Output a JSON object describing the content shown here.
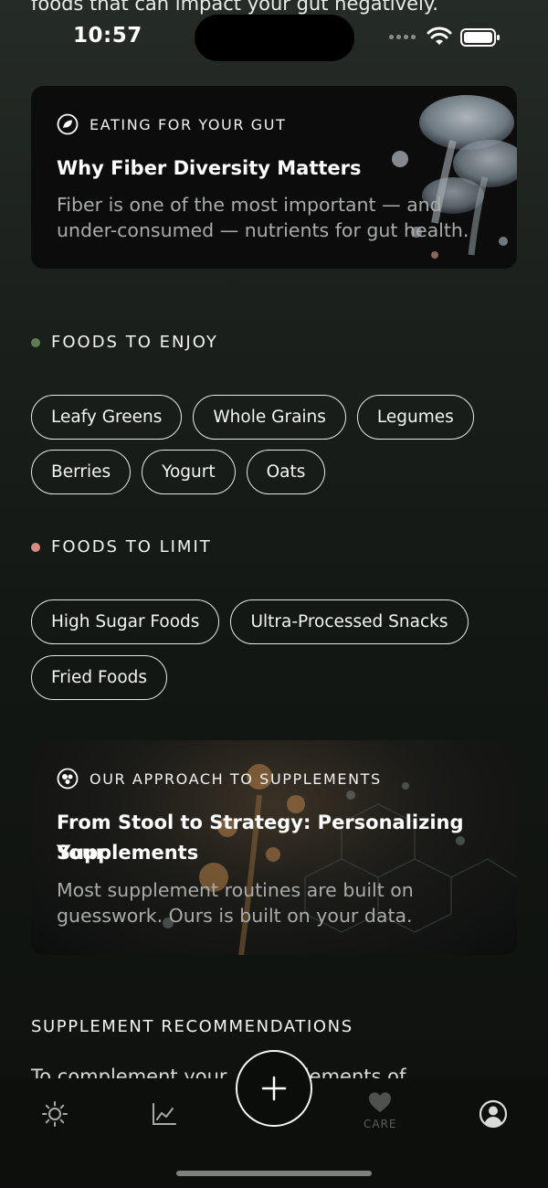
{
  "top_cut_text": "foods that can impact your gut negatively.",
  "status_bar": {
    "time": "10:57"
  },
  "fiber_card": {
    "eyebrow": "EATING FOR YOUR GUT",
    "title": "Why Fiber Diversity Matters",
    "description_line1": "Fiber is one of the most important — and",
    "description_line2": "under-consumed — nutrients for gut health."
  },
  "enjoy_section": {
    "heading": "FOODS TO ENJOY",
    "dot_color": "#5e7d52",
    "foods": [
      "Leafy Greens",
      "Whole Grains",
      "Legumes",
      "Berries",
      "Yogurt",
      "Oats"
    ]
  },
  "limit_section": {
    "heading": "FOODS TO LIMIT",
    "dot_color": "#d98a82",
    "foods": [
      "High Sugar Foods",
      "Ultra-Processed Snacks",
      "Fried Foods"
    ]
  },
  "supplements_card": {
    "eyebrow": "OUR APPROACH TO SUPPLEMENTS",
    "title_line1": "From Stool to Strategy: Personalizing Your",
    "title_line2": "Supplements",
    "description_line1": "Most supplement routines are built on",
    "description_line2": "guesswork. Ours is built on your data."
  },
  "supplement_recommendations": {
    "heading": "SUPPLEMENT RECOMMENDATIONS",
    "cut_text": "To complement your ... supplements of"
  },
  "tab_bar": {
    "home_icon": "sun-icon",
    "chart_icon": "chart-icon",
    "add_icon": "plus-icon",
    "care_label": "CARE",
    "care_icon": "heart-icon",
    "profile_icon": "profile-icon"
  }
}
